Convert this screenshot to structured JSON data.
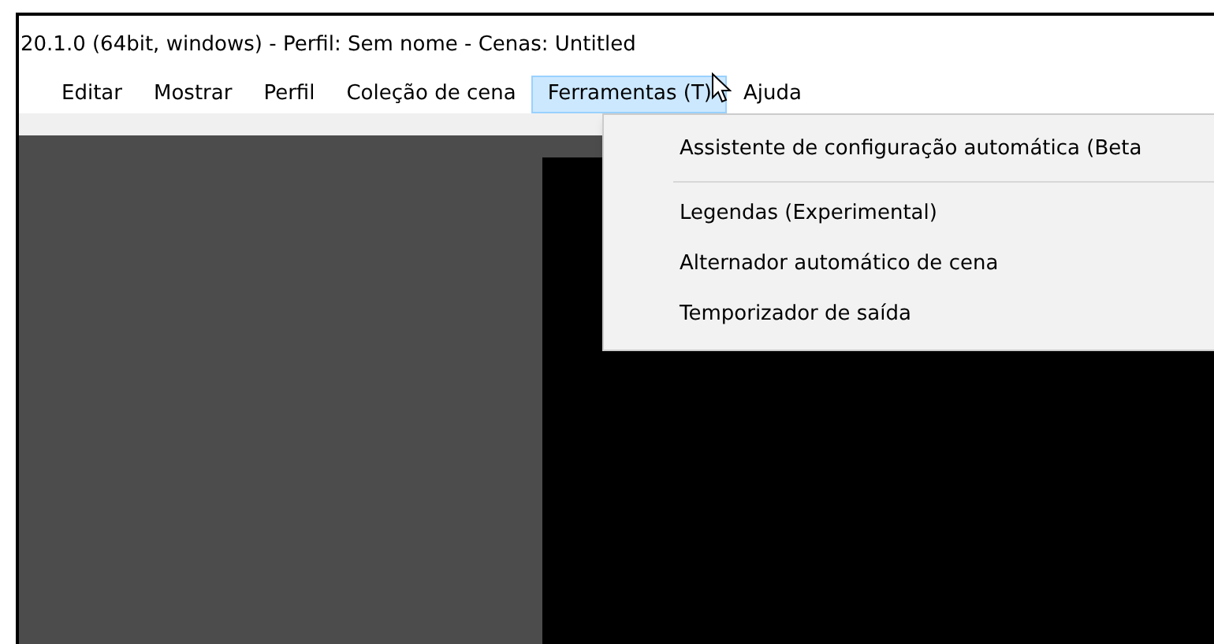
{
  "window": {
    "title": "20.1.0 (64bit, windows) - Perfil: Sem nome - Cenas: Untitled"
  },
  "menu_bar": [
    {
      "label": "Editar",
      "selected": false
    },
    {
      "label": "Mostrar",
      "selected": false
    },
    {
      "label": "Perfil",
      "selected": false
    },
    {
      "label": "Coleção de cena",
      "selected": false
    },
    {
      "label": "Ferramentas (T)",
      "selected": true
    },
    {
      "label": "Ajuda",
      "selected": false
    }
  ],
  "dropdown": {
    "items": [
      {
        "kind": "item",
        "label": "Assistente de configuração automática (Beta"
      },
      {
        "kind": "separator"
      },
      {
        "kind": "item",
        "label": "Legendas (Experimental)"
      },
      {
        "kind": "item",
        "label": "Alternador automático de cena"
      },
      {
        "kind": "item",
        "label": "Temporizador de saída"
      }
    ]
  }
}
